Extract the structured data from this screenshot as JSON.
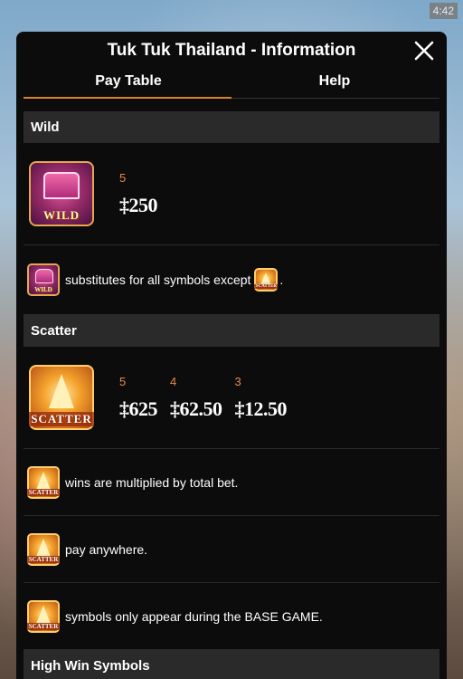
{
  "status": {
    "time": "4:42"
  },
  "header": {
    "title": "Tuk Tuk Thailand - Information"
  },
  "tabs": [
    {
      "label": "Pay Table"
    },
    {
      "label": "Help"
    }
  ],
  "sections": {
    "wild": {
      "title": "Wild",
      "symbol_label": "WILD",
      "pays": [
        {
          "count": "5",
          "value": "‡250"
        }
      ],
      "desc": "substitutes for all symbols except",
      "desc_end": "."
    },
    "scatter": {
      "title": "Scatter",
      "symbol_label": "SCATTER",
      "pays": [
        {
          "count": "5",
          "value": "‡625"
        },
        {
          "count": "4",
          "value": "‡62.50"
        },
        {
          "count": "3",
          "value": "‡12.50"
        }
      ],
      "notes": [
        "wins are multiplied by total bet.",
        "pay anywhere.",
        "symbols only appear during the BASE GAME."
      ]
    },
    "high": {
      "title": "High Win Symbols"
    }
  },
  "colors": {
    "accent": "#d9822b",
    "pay_count": "#e8894a",
    "panel": "#0c0c0c",
    "section_bg": "#2a2a2a"
  }
}
